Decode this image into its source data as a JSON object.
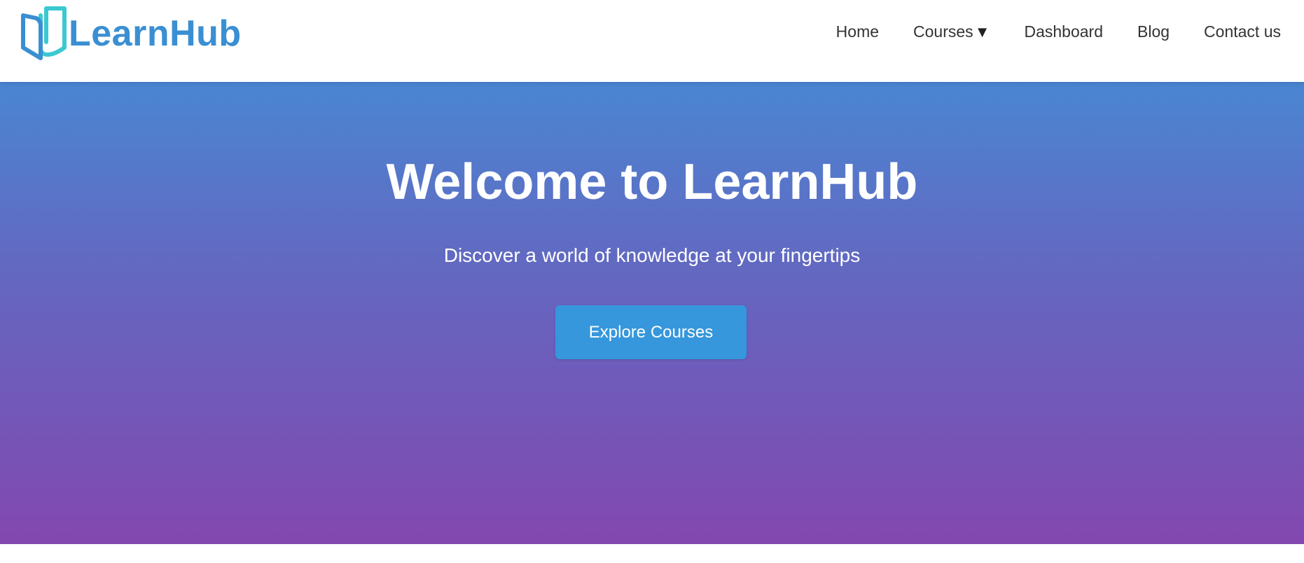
{
  "header": {
    "logo_text": "LearnHub",
    "logo_icon": "open-book-icon",
    "nav": {
      "home": "Home",
      "courses": "Courses",
      "courses_caret": "▼",
      "dashboard": "Dashboard",
      "blog": "Blog",
      "contact": "Contact us"
    }
  },
  "hero": {
    "title": "Welcome to LearnHub",
    "subtitle": "Discover a world of knowledge at your fingertips",
    "cta_label": "Explore Courses"
  },
  "colors": {
    "brand": "#3a8fd3",
    "brand_accent": "#3cc8d2",
    "hero_gradient_top": "#4a86d2",
    "hero_gradient_bottom": "#8248b0",
    "cta_background": "#3697dc",
    "nav_text": "#333333"
  }
}
